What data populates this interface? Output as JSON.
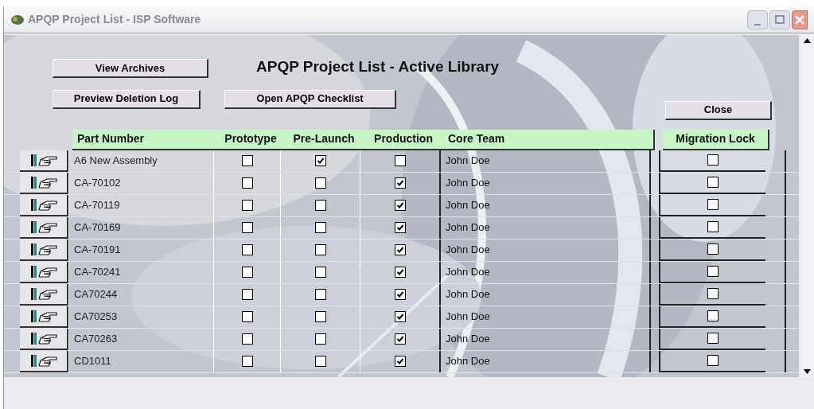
{
  "window": {
    "title": "APQP Project List - ISP Software"
  },
  "heading": "APQP Project List - Active Library",
  "buttons": {
    "view_archives": "View Archives",
    "preview_deletion_log": "Preview Deletion Log",
    "open_checklist": "Open APQP Checklist",
    "close": "Close"
  },
  "table": {
    "columns": [
      "Part Number",
      "Prototype",
      "Pre-Launch",
      "Production",
      "Core Team",
      "Migration Lock"
    ],
    "rows": [
      {
        "part_number": "A6 New Assembly",
        "prototype": false,
        "pre_launch": true,
        "production": false,
        "core_team": "John Doe",
        "migration_lock": false
      },
      {
        "part_number": "CA-70102",
        "prototype": false,
        "pre_launch": false,
        "production": true,
        "core_team": "John Doe",
        "migration_lock": false
      },
      {
        "part_number": "CA-70119",
        "prototype": false,
        "pre_launch": false,
        "production": true,
        "core_team": "John Doe",
        "migration_lock": false
      },
      {
        "part_number": "CA-70169",
        "prototype": false,
        "pre_launch": false,
        "production": true,
        "core_team": "John Doe",
        "migration_lock": false
      },
      {
        "part_number": "CA-70191",
        "prototype": false,
        "pre_launch": false,
        "production": true,
        "core_team": "John Doe",
        "migration_lock": false
      },
      {
        "part_number": "CA-70241",
        "prototype": false,
        "pre_launch": false,
        "production": true,
        "core_team": "John Doe",
        "migration_lock": false
      },
      {
        "part_number": "CA70244",
        "prototype": false,
        "pre_launch": false,
        "production": true,
        "core_team": "John Doe",
        "migration_lock": false
      },
      {
        "part_number": "CA70253",
        "prototype": false,
        "pre_launch": false,
        "production": true,
        "core_team": "John Doe",
        "migration_lock": false
      },
      {
        "part_number": "CA70263",
        "prototype": false,
        "pre_launch": false,
        "production": true,
        "core_team": "John Doe",
        "migration_lock": false
      },
      {
        "part_number": "CD1011",
        "prototype": false,
        "pre_launch": false,
        "production": true,
        "core_team": "John Doe",
        "migration_lock": false
      }
    ]
  }
}
